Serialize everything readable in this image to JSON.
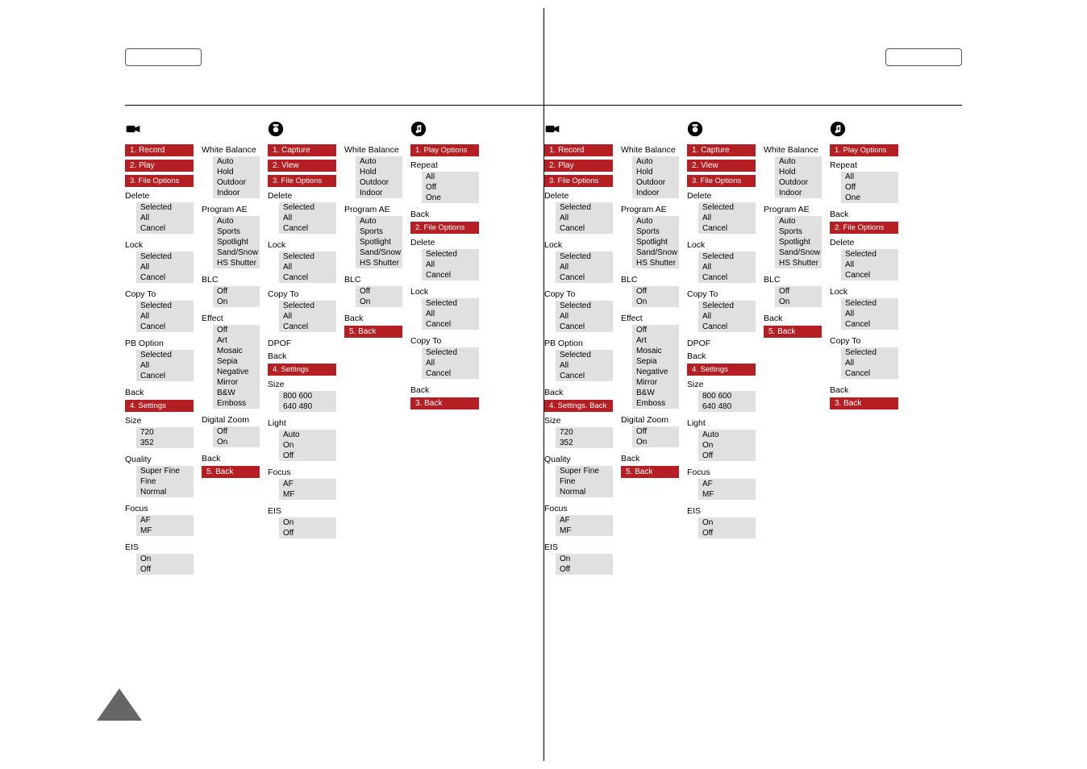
{
  "left": {
    "video": {
      "menus": [
        "1. Record",
        "2. Play",
        "3. File Options"
      ],
      "delete": {
        "h": "Delete",
        "o": [
          "Selected",
          "All",
          "Cancel"
        ]
      },
      "lock": {
        "h": "Lock",
        "o": [
          "Selected",
          "All",
          "Cancel"
        ]
      },
      "copyto": {
        "h": "Copy To",
        "o": [
          "Selected",
          "All",
          "Cancel"
        ]
      },
      "pboption": {
        "h": "PB Option",
        "o": [
          "Selected",
          "All",
          "Cancel"
        ]
      },
      "back1": "Back",
      "settings_bar": "4. Settings",
      "size": {
        "h": "Size",
        "o": [
          "720",
          "352"
        ]
      },
      "quality": {
        "h": "Quality",
        "o": [
          "Super Fine",
          "Fine",
          "Normal"
        ]
      },
      "focus": {
        "h": "Focus",
        "o": [
          "AF",
          "MF"
        ]
      },
      "eis": {
        "h": "EIS",
        "o": [
          "On",
          "Off"
        ]
      },
      "wb": {
        "h": "White Balance",
        "o": [
          "Auto",
          "Hold",
          "Outdoor",
          "Indoor"
        ]
      },
      "pae": {
        "h": "Program AE",
        "o": [
          "Auto",
          "Sports",
          "Spotlight",
          "Sand/Snow",
          "HS Shutter"
        ]
      },
      "blc": {
        "h": "BLC",
        "o": [
          "Off",
          "On"
        ]
      },
      "effect": {
        "h": "Effect",
        "o": [
          "Off",
          "Art",
          "Mosaic",
          "Sepia",
          "Negative",
          "Mirror",
          "B&W",
          "Emboss"
        ]
      },
      "dz": {
        "h": "Digital Zoom",
        "o": [
          "Off",
          "On"
        ]
      },
      "back2": "Back",
      "back_bar": "5. Back"
    },
    "photo": {
      "menus": [
        "1. Capture",
        "2. View",
        "3. File Options"
      ],
      "delete": {
        "h": "Delete",
        "o": [
          "Selected",
          "All",
          "Cancel"
        ]
      },
      "lock": {
        "h": "Lock",
        "o": [
          "Selected",
          "All",
          "Cancel"
        ]
      },
      "copyto": {
        "h": "Copy To",
        "o": [
          "Selected",
          "All",
          "Cancel"
        ]
      },
      "dpof": "DPOF",
      "back1": "Back",
      "settings_bar": "4. Settings",
      "size": {
        "h": "Size",
        "o": [
          "800   600",
          "640   480"
        ]
      },
      "light": {
        "h": "Light",
        "o": [
          "Auto",
          "On",
          "Off"
        ]
      },
      "focus": {
        "h": "Focus",
        "o": [
          "AF",
          "MF"
        ]
      },
      "eis": {
        "h": "EIS",
        "o": [
          "On",
          "Off"
        ]
      },
      "wb": {
        "h": "White Balance",
        "o": [
          "Auto",
          "Hold",
          "Outdoor",
          "Indoor"
        ]
      },
      "pae": {
        "h": "Program AE",
        "o": [
          "Auto",
          "Sports",
          "Spotlight",
          "Sand/Snow",
          "HS Shutter"
        ]
      },
      "blc": {
        "h": "BLC",
        "o": [
          "Off",
          "On"
        ]
      },
      "back2": "Back",
      "back_bar": "5. Back"
    },
    "music": {
      "playopt_bar": "1. Play Options",
      "repeat": {
        "h": "Repeat",
        "o": [
          "All",
          "Off",
          "One"
        ]
      },
      "back1": "Back",
      "fileopt_bar": "2. File Options",
      "delete": {
        "h": "Delete",
        "o": [
          "Selected",
          "All",
          "Cancel"
        ]
      },
      "lock": {
        "h": "Lock",
        "o": [
          "Selected",
          "All",
          "Cancel"
        ]
      },
      "copyto": {
        "h": "Copy To",
        "o": [
          "Selected",
          "All",
          "Cancel"
        ]
      },
      "back2": "Back",
      "back_bar": "3. Back"
    }
  },
  "right": {
    "video": {
      "menus": [
        "1. Record",
        "2. Play",
        "3. File Options"
      ],
      "delete": {
        "h": "Delete",
        "o": [
          "Selected",
          "All",
          "Cancel"
        ]
      },
      "lock": {
        "h": "Lock",
        "o": [
          "Selected",
          "All",
          "Cancel"
        ]
      },
      "copyto": {
        "h": "Copy To",
        "o": [
          "Selected",
          "All",
          "Cancel"
        ]
      },
      "pboption": {
        "h": "PB Option",
        "o": [
          "Selected",
          "All",
          "Cancel"
        ]
      },
      "back1": "Back",
      "settings_bar": "4. Settings. Back",
      "size": {
        "h": "Size",
        "o": [
          "720",
          "352"
        ]
      },
      "quality": {
        "h": "Quality",
        "o": [
          "Super Fine",
          "Fine",
          "Normal"
        ]
      },
      "focus": {
        "h": "Focus",
        "o": [
          "AF",
          "MF"
        ]
      },
      "eis": {
        "h": "EIS",
        "o": [
          "On",
          "Off"
        ]
      },
      "wb": {
        "h": "White Balance",
        "o": [
          "Auto",
          "Hold",
          "Outdoor",
          "Indoor"
        ]
      },
      "pae": {
        "h": "Program AE",
        "o": [
          "Auto",
          "Sports",
          "Spotlight",
          "Sand/Snow",
          "HS Shutter"
        ]
      },
      "blc": {
        "h": "BLC",
        "o": [
          "Off",
          "On"
        ]
      },
      "effect": {
        "h": "Effect",
        "o": [
          "Off",
          "Art",
          "Mosaic",
          "Sepia",
          "Negative",
          "Mirror",
          "B&W",
          "Emboss"
        ]
      },
      "dz": {
        "h": "Digital Zoom",
        "o": [
          "Off",
          "On"
        ]
      },
      "back2": "Back",
      "back_bar": "5. Back"
    },
    "photo": {
      "menus": [
        "1. Capture",
        "2. View",
        "3. File Options"
      ],
      "delete": {
        "h": "Delete",
        "o": [
          "Selected",
          "All",
          "Cancel"
        ]
      },
      "lock": {
        "h": "Lock",
        "o": [
          "Selected",
          "All",
          "Cancel"
        ]
      },
      "copyto": {
        "h": "Copy To",
        "o": [
          "Selected",
          "All",
          "Cancel"
        ]
      },
      "dpof": "DPOF",
      "back1": "Back",
      "settings_bar": "4. Settings",
      "size": {
        "h": "Size",
        "o": [
          "800   600",
          "640   480"
        ]
      },
      "light": {
        "h": "Light",
        "o": [
          "Auto",
          "On",
          "Off"
        ]
      },
      "focus": {
        "h": "Focus",
        "o": [
          "AF",
          "MF"
        ]
      },
      "eis": {
        "h": "EIS",
        "o": [
          "On",
          "Off"
        ]
      },
      "wb": {
        "h": "White Balance",
        "o": [
          "Auto",
          "Hold",
          "Outdoor",
          "Indoor"
        ]
      },
      "pae": {
        "h": "Program AE",
        "o": [
          "Auto",
          "Sports",
          "Spotlight",
          "Sand/Snow",
          "HS Shutter"
        ]
      },
      "blc": {
        "h": "BLC",
        "o": [
          "Off",
          "On"
        ]
      },
      "back2": "Back",
      "back_bar": "5. Back"
    },
    "music": {
      "playopt_bar": "1. Play Options",
      "repeat": {
        "h": "Repeat",
        "o": [
          "All",
          "Off",
          "One"
        ]
      },
      "back1": "Back",
      "fileopt_bar": "2. File Options",
      "delete": {
        "h": "Delete",
        "o": [
          "Selected",
          "All",
          "Cancel"
        ]
      },
      "lock": {
        "h": "Lock",
        "o": [
          "Selected",
          "All",
          "Cancel"
        ]
      },
      "copyto": {
        "h": "Copy To",
        "o": [
          "Selected",
          "All",
          "Cancel"
        ]
      },
      "back2": "Back",
      "back_bar": "3. Back"
    }
  }
}
